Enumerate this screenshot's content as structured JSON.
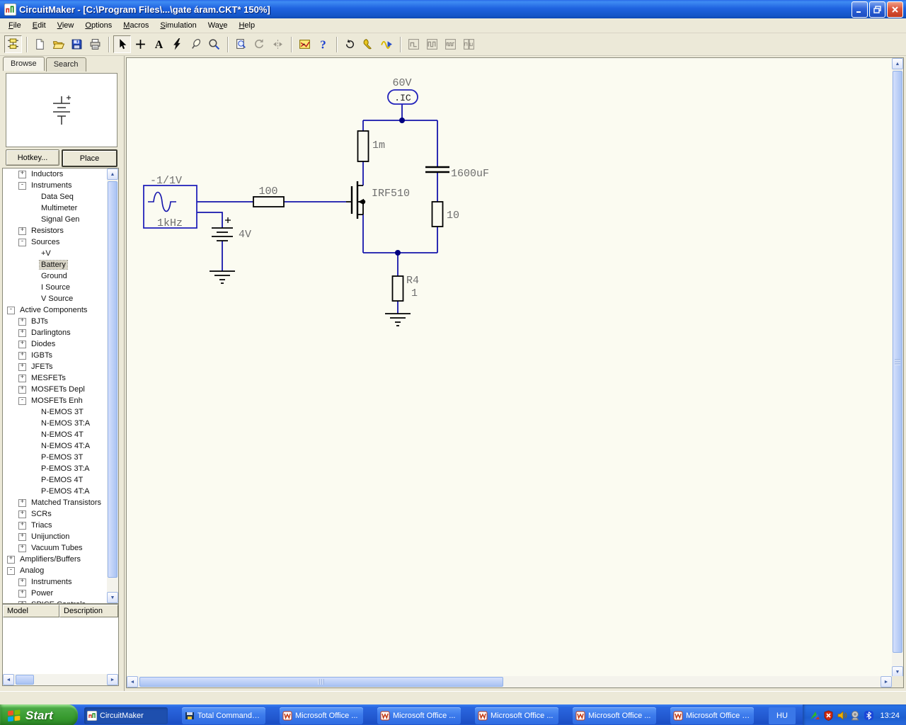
{
  "window": {
    "title": "CircuitMaker - [C:\\Program Files\\...\\gate áram.CKT* 150%]"
  },
  "menu": {
    "items": [
      {
        "label": "File",
        "accel": "F"
      },
      {
        "label": "Edit",
        "accel": "E"
      },
      {
        "label": "View",
        "accel": "V"
      },
      {
        "label": "Options",
        "accel": "O"
      },
      {
        "label": "Macros",
        "accel": "M"
      },
      {
        "label": "Simulation",
        "accel": "S"
      },
      {
        "label": "Wave",
        "accel": "v"
      },
      {
        "label": "Help",
        "accel": "H"
      }
    ]
  },
  "toolbar": {
    "icons": [
      "browse-components",
      "new-document",
      "open-file",
      "save-file",
      "print",
      "select-cursor",
      "wire-plus-tool",
      "text-tool",
      "delete-bolt-tool",
      "probe-tool",
      "zoom-tool",
      "page-preview",
      "rotate",
      "mirror-flip",
      "switch-mode",
      "help",
      "reset",
      "options-wrench",
      "run-waveform",
      "scope-display-1",
      "scope-display-2",
      "scope-display-3",
      "scope-display-4"
    ]
  },
  "sidebar": {
    "tabs": [
      {
        "label": "Browse",
        "active": true
      },
      {
        "label": "Search",
        "active": false
      }
    ],
    "preview_symbol": "battery-symbol",
    "hotkey_button": "Hotkey...",
    "place_button": "Place",
    "model_column": "Model",
    "description_column": "Description",
    "tree": [
      {
        "depth": 1,
        "expander": "+",
        "label": "Inductors",
        "selected": false
      },
      {
        "depth": 1,
        "expander": "-",
        "label": "Instruments",
        "selected": false
      },
      {
        "depth": 2,
        "expander": null,
        "label": "Data Seq",
        "selected": false
      },
      {
        "depth": 2,
        "expander": null,
        "label": "Multimeter",
        "selected": false
      },
      {
        "depth": 2,
        "expander": null,
        "label": "Signal Gen",
        "selected": false
      },
      {
        "depth": 1,
        "expander": "+",
        "label": "Resistors",
        "selected": false
      },
      {
        "depth": 1,
        "expander": "-",
        "label": "Sources",
        "selected": false
      },
      {
        "depth": 2,
        "expander": null,
        "label": "+V",
        "selected": false
      },
      {
        "depth": 2,
        "expander": null,
        "label": "Battery",
        "selected": true
      },
      {
        "depth": 2,
        "expander": null,
        "label": "Ground",
        "selected": false
      },
      {
        "depth": 2,
        "expander": null,
        "label": "I Source",
        "selected": false
      },
      {
        "depth": 2,
        "expander": null,
        "label": "V Source",
        "selected": false
      },
      {
        "depth": 0,
        "expander": "-",
        "label": "Active Components",
        "selected": false
      },
      {
        "depth": 1,
        "expander": "+",
        "label": "BJTs",
        "selected": false
      },
      {
        "depth": 1,
        "expander": "+",
        "label": "Darlingtons",
        "selected": false
      },
      {
        "depth": 1,
        "expander": "+",
        "label": "Diodes",
        "selected": false
      },
      {
        "depth": 1,
        "expander": "+",
        "label": "IGBTs",
        "selected": false
      },
      {
        "depth": 1,
        "expander": "+",
        "label": "JFETs",
        "selected": false
      },
      {
        "depth": 1,
        "expander": "+",
        "label": "MESFETs",
        "selected": false
      },
      {
        "depth": 1,
        "expander": "+",
        "label": "MOSFETs Depl",
        "selected": false
      },
      {
        "depth": 1,
        "expander": "-",
        "label": "MOSFETs Enh",
        "selected": false
      },
      {
        "depth": 2,
        "expander": null,
        "label": "N-EMOS 3T",
        "selected": false
      },
      {
        "depth": 2,
        "expander": null,
        "label": "N-EMOS 3T:A",
        "selected": false
      },
      {
        "depth": 2,
        "expander": null,
        "label": "N-EMOS 4T",
        "selected": false
      },
      {
        "depth": 2,
        "expander": null,
        "label": "N-EMOS 4T:A",
        "selected": false
      },
      {
        "depth": 2,
        "expander": null,
        "label": "P-EMOS 3T",
        "selected": false
      },
      {
        "depth": 2,
        "expander": null,
        "label": "P-EMOS 3T:A",
        "selected": false
      },
      {
        "depth": 2,
        "expander": null,
        "label": "P-EMOS 4T",
        "selected": false
      },
      {
        "depth": 2,
        "expander": null,
        "label": "P-EMOS 4T:A",
        "selected": false
      },
      {
        "depth": 1,
        "expander": "+",
        "label": "Matched Transistors",
        "selected": false
      },
      {
        "depth": 1,
        "expander": "+",
        "label": "SCRs",
        "selected": false
      },
      {
        "depth": 1,
        "expander": "+",
        "label": "Triacs",
        "selected": false
      },
      {
        "depth": 1,
        "expander": "+",
        "label": "Unijunction",
        "selected": false
      },
      {
        "depth": 1,
        "expander": "+",
        "label": "Vacuum Tubes",
        "selected": false
      },
      {
        "depth": 0,
        "expander": "+",
        "label": "Amplifiers/Buffers",
        "selected": false
      },
      {
        "depth": 0,
        "expander": "-",
        "label": "Analog",
        "selected": false
      },
      {
        "depth": 1,
        "expander": "+",
        "label": "Instruments",
        "selected": false
      },
      {
        "depth": 1,
        "expander": "+",
        "label": "Power",
        "selected": false
      },
      {
        "depth": 1,
        "expander": "+",
        "label": "SPICE Controls",
        "selected": false
      }
    ]
  },
  "schematic": {
    "initial_condition": {
      "voltage": "60V",
      "marker": ".IC"
    },
    "resistor_top": "1m",
    "capacitor": "1600uF",
    "resistor_right": "10",
    "mosfet": "IRF510",
    "gate_resistor": "100",
    "signal_source": {
      "amplitude": "-1/1V",
      "frequency": "1kHz"
    },
    "battery": {
      "value": "4V",
      "polarity": "+"
    },
    "resistor_r4": {
      "name": "R4",
      "value": "1"
    }
  },
  "taskbar": {
    "start_label": "Start",
    "buttons": [
      {
        "label": "CircuitMaker",
        "icon": "circuitmaker-icon",
        "active": true
      },
      {
        "label": "Total Commander...",
        "icon": "total-commander-icon",
        "active": false
      },
      {
        "label": "Microsoft Office ...",
        "icon": "office-doc-icon",
        "active": false
      },
      {
        "label": "Microsoft Office ...",
        "icon": "office-doc-icon",
        "active": false
      },
      {
        "label": "Microsoft Office ...",
        "icon": "office-doc-icon",
        "active": false
      },
      {
        "label": "Microsoft Office ...",
        "icon": "office-doc-icon",
        "active": false
      },
      {
        "label": "Microsoft Office P...",
        "icon": "office-doc-icon",
        "active": false
      }
    ],
    "language_indicator": "HU",
    "tray_icons": [
      "input-device-icon",
      "security-alert-icon",
      "volume-icon",
      "audio-device-icon",
      "bluetooth-icon"
    ],
    "clock": "13:24"
  },
  "colors": {
    "titlebar_blue": "#1f63e0",
    "taskbar_blue": "#2258cf",
    "chrome_beige": "#ece9d8",
    "canvas_bg": "#fbfbf1",
    "wire_blue": "#1515ac",
    "label_gray": "#6e6e6e",
    "close_red": "#dd553a",
    "start_green": "#379a2e"
  }
}
